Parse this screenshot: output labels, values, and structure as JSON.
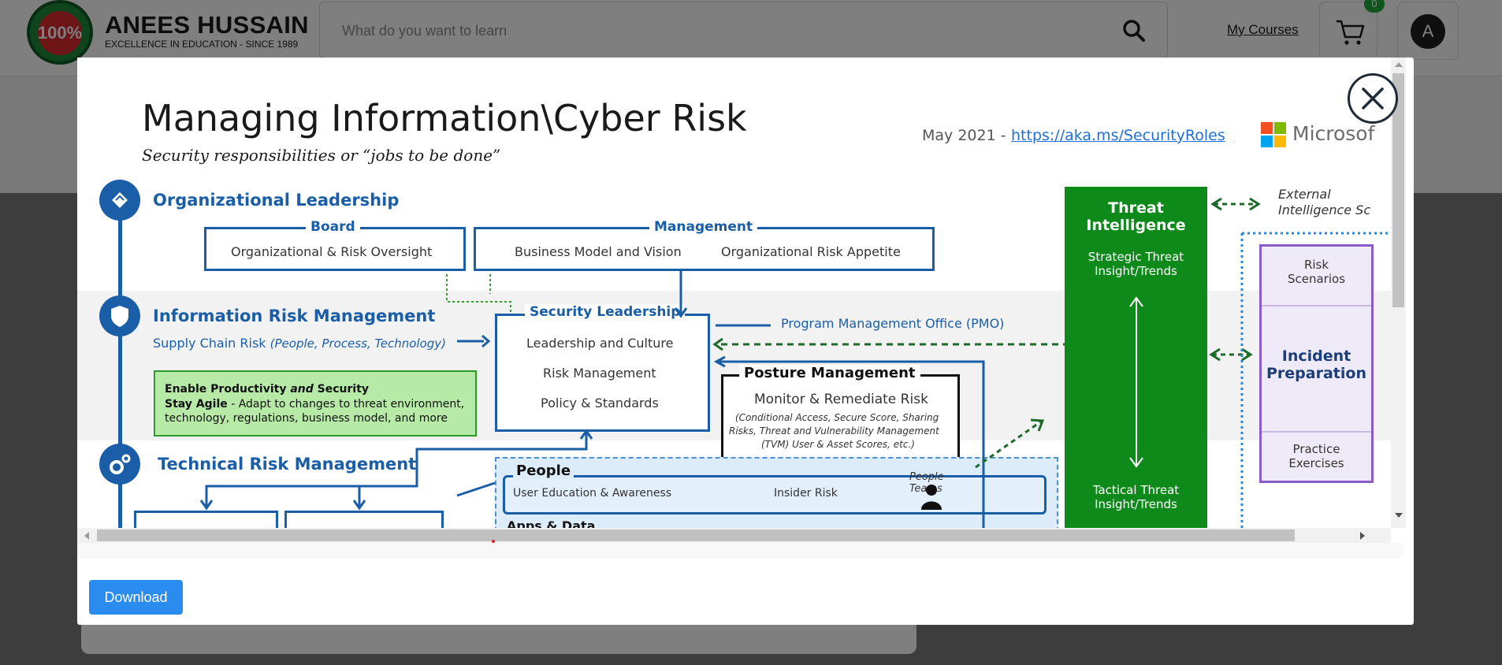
{
  "header": {
    "logo_text": "100%",
    "logo_ring_text": "ANEES HUSSAIN · EXCELLENCE IN EDUCATION",
    "brand_name": "ANEES HUSSAIN",
    "brand_tagline": "EXCELLENCE IN EDUCATION - SINCE 1989",
    "search_placeholder": "What do you want to learn",
    "my_courses_label": "My Courses",
    "cart_count": "0",
    "avatar_initial": "A"
  },
  "modal": {
    "download_label": "Download",
    "close_icon": "close-icon",
    "infographic": {
      "title": "Managing Information\\Cyber Risk",
      "subtitle": "Security responsibilities or “jobs to be done”",
      "date_prefix": "May 2021 -",
      "link": "https://aka.ms/SecurityRoles",
      "brand": "Microsof",
      "sections": {
        "org_leadership": "Organizational Leadership",
        "info_risk": "Information Risk Management",
        "tech_risk": "Technical Risk Management"
      },
      "board": {
        "label": "Board",
        "text": "Organizational & Risk Oversight"
      },
      "management": {
        "label": "Management",
        "item1": "Business Model and Vision",
        "item2": "Organizational Risk Appetite"
      },
      "security_leadership": {
        "label": "Security Leadership",
        "item1": "Leadership and Culture",
        "item2": "Risk Management",
        "item3": "Policy & Standards"
      },
      "supply_chain": "Supply Chain Risk",
      "supply_chain_detail": "(People, Process, Technology)",
      "pmo": "Program Management Office (PMO)",
      "enable_title_a": "Enable Productivity",
      "enable_title_and": "and",
      "enable_title_b": "Security",
      "stay_agile": "Stay Agile",
      "stay_agile_text_1": "- Adapt to changes to threat environment,",
      "stay_agile_text_2": "technology, regulations, business model, and more",
      "posture": {
        "label": "Posture Management",
        "line1": "Monitor & Remediate Risk",
        "detail1": "(Conditional Access, Secure Score, Sharing",
        "detail2": "Risks, Threat and Vulnerability Management",
        "detail3": "(TVM) User & Asset Scores, etc.)"
      },
      "people": {
        "label": "People",
        "item1": "User Education & Awareness",
        "item2": "Insider Risk",
        "teams_1": "People",
        "teams_2": "Teams"
      },
      "apps_data_partial": "Apps & Data",
      "threat_intel": {
        "title_1": "Threat",
        "title_2": "Intelligence",
        "strategic_1": "Strategic Threat",
        "strategic_2": "Insight/Trends",
        "tactical_1": "Tactical Threat",
        "tactical_2": "Insight/Trends"
      },
      "external_1": "External",
      "external_2": "Intelligence Sc",
      "incident": {
        "risk_1": "Risk",
        "risk_2": "Scenarios",
        "main_1": "Incident",
        "main_2": "Preparation",
        "practice_1": "Practice",
        "practice_2": "Exercises"
      }
    }
  }
}
